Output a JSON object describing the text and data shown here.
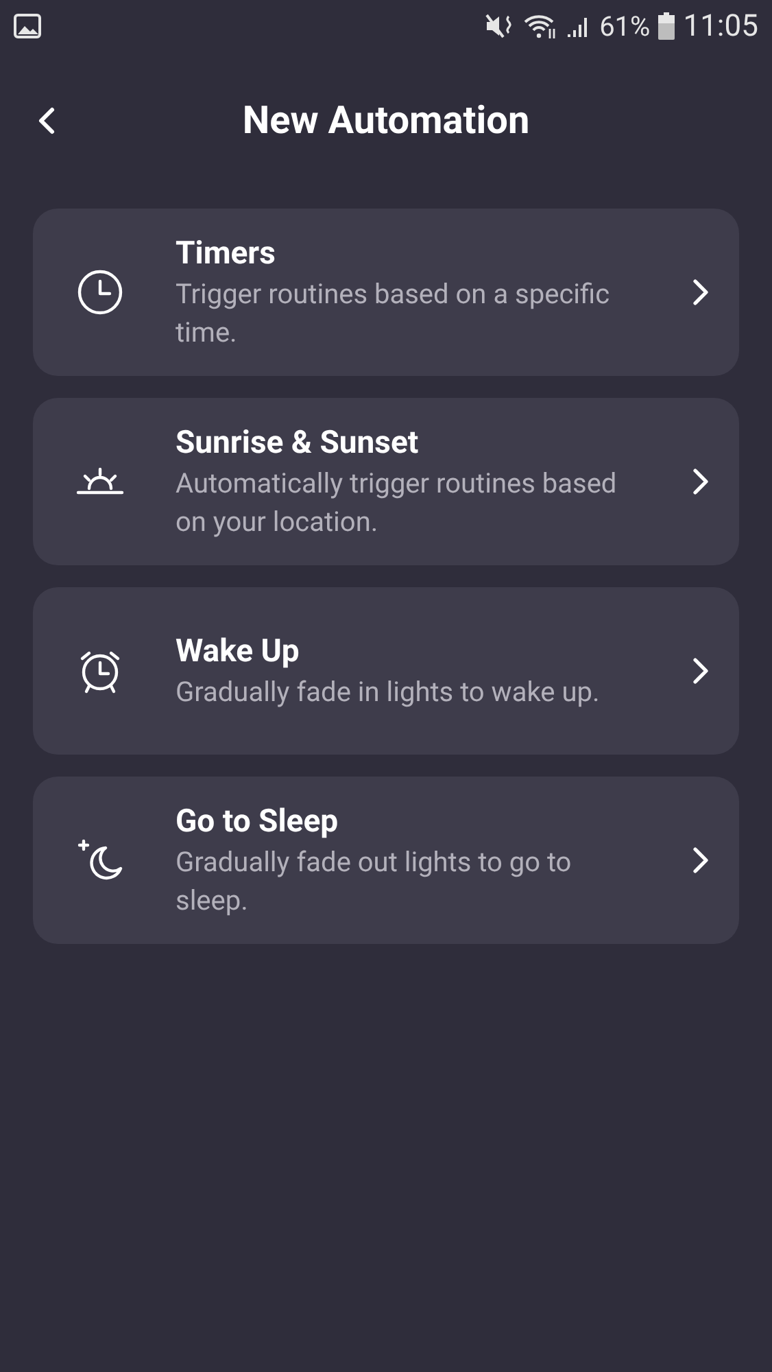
{
  "status_bar": {
    "battery": "61%",
    "time": "11:05"
  },
  "header": {
    "title": "New Automation"
  },
  "items": [
    {
      "kind": "clock",
      "title": "Timers",
      "description": "Trigger routines based on a specific time."
    },
    {
      "kind": "sunrise",
      "title": "Sunrise & Sunset",
      "description": "Automatically trigger routines based on your location."
    },
    {
      "kind": "alarm",
      "title": "Wake Up",
      "description": "Gradually fade in lights to wake up."
    },
    {
      "kind": "moon",
      "title": "Go to Sleep",
      "description": "Gradually fade out lights to go to sleep."
    }
  ]
}
